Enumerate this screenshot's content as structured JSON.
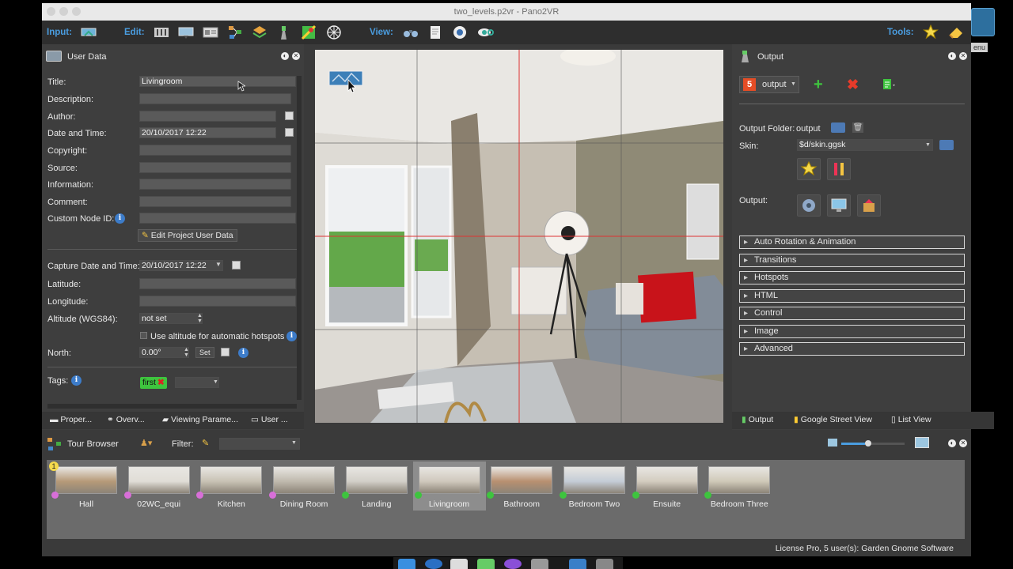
{
  "window": {
    "title": "two_levels.p2vr - Pano2VR"
  },
  "toolbar": {
    "input_label": "Input:",
    "edit_label": "Edit:",
    "view_label": "View:",
    "tools_label": "Tools:",
    "icons": [
      "input-panorama-icon",
      "edit-sliders-icon",
      "edit-viewing-icon",
      "edit-userdata-icon",
      "edit-tour-icon",
      "edit-patches-icon",
      "edit-hotspots-icon",
      "edit-map-icon",
      "edit-ball-icon",
      "view-binoculars-icon",
      "view-notes-icon",
      "view-globe-icon",
      "view-eye-icon",
      "tools-wizard-icon",
      "tools-eraser-icon"
    ]
  },
  "right_edge": {
    "label": "enu"
  },
  "user_data": {
    "title": "User Data",
    "fields": {
      "title_label": "Title:",
      "title_value": "Livingroom",
      "description_label": "Description:",
      "description_value": "",
      "author_label": "Author:",
      "author_value": "",
      "datetime_label": "Date and Time:",
      "datetime_value": "20/10/2017 12:22",
      "copyright_label": "Copyright:",
      "copyright_value": "",
      "source_label": "Source:",
      "source_value": "",
      "information_label": "Information:",
      "information_value": "",
      "comment_label": "Comment:",
      "comment_value": "",
      "nodeid_label": "Custom Node ID:",
      "nodeid_value": ""
    },
    "edit_project_button": "Edit Project User Data",
    "capture_label": "Capture Date and Time:",
    "capture_value": "20/10/2017 12:22",
    "latitude_label": "Latitude:",
    "longitude_label": "Longitude:",
    "altitude_label": "Altitude (WGS84):",
    "altitude_value": "not set",
    "use_altitude_label": "Use altitude for automatic hotspots",
    "north_label": "North:",
    "north_value": "0.00°",
    "set_button": "Set",
    "tags_label": "Tags:",
    "tag_first": "first"
  },
  "left_tabs": [
    "Proper...",
    "Overv...",
    "Viewing Parame...",
    "User ..."
  ],
  "output_panel": {
    "title": "Output",
    "format_button": "output",
    "folder_label": "Output Folder:",
    "folder_value": "output",
    "skin_label": "Skin:",
    "skin_value": "$d/skin.ggsk",
    "output_label": "Output:",
    "sections": [
      "Auto Rotation & Animation",
      "Transitions",
      "Hotspots",
      "HTML",
      "Control",
      "Image",
      "Advanced"
    ]
  },
  "right_tabs": [
    "Output",
    "Google Street View",
    "List View"
  ],
  "tour_browser": {
    "title": "Tour Browser",
    "filter_label": "Filter:",
    "badge": "1",
    "nodes": [
      {
        "name": "Hall",
        "dot": "#d86fd8"
      },
      {
        "name": "02WC_equi",
        "dot": "#d86fd8"
      },
      {
        "name": "Kitchen",
        "dot": "#d86fd8"
      },
      {
        "name": "Dining Room",
        "dot": "#d86fd8"
      },
      {
        "name": "Landing",
        "dot": "#3ec43e"
      },
      {
        "name": "Livingroom",
        "dot": "#3ec43e",
        "selected": true
      },
      {
        "name": "Bathroom",
        "dot": "#3ec43e"
      },
      {
        "name": "Bedroom Two",
        "dot": "#3ec43e"
      },
      {
        "name": "Ensuite",
        "dot": "#3ec43e"
      },
      {
        "name": "Bedroom Three",
        "dot": "#3ec43e"
      }
    ]
  },
  "status": {
    "license": "License Pro, 5 user(s): Garden Gnome Software"
  },
  "colors": {
    "accent": "#4a9de0",
    "tag_green": "#3ec43e",
    "guide_red": "#d33"
  }
}
